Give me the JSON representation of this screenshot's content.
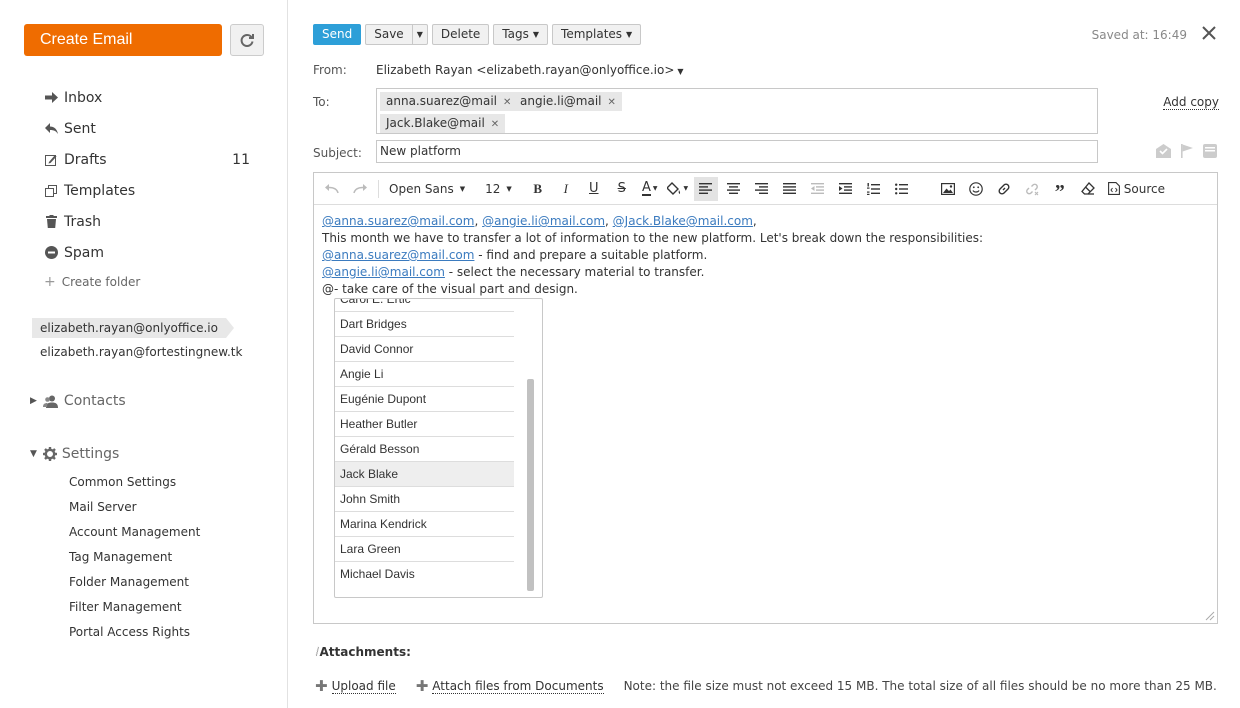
{
  "sidebar": {
    "create_email": "Create Email",
    "folders": [
      {
        "label": "Inbox",
        "count": ""
      },
      {
        "label": "Sent",
        "count": ""
      },
      {
        "label": "Drafts",
        "count": "11"
      },
      {
        "label": "Templates",
        "count": ""
      },
      {
        "label": "Trash",
        "count": ""
      },
      {
        "label": "Spam",
        "count": ""
      }
    ],
    "create_folder": "Create folder",
    "accounts": [
      "elizabeth.rayan@onlyoffice.io",
      "elizabeth.rayan@fortestingnew.tk"
    ],
    "contacts": "Contacts",
    "settings": "Settings",
    "settings_items": [
      "Common Settings",
      "Mail Server",
      "Account Management",
      "Tag Management",
      "Folder Management",
      "Filter Management",
      "Portal Access Rights"
    ]
  },
  "toolbar": {
    "send": "Send",
    "save": "Save",
    "delete": "Delete",
    "tags": "Tags",
    "templates": "Templates",
    "saved": "Saved at: 16:49"
  },
  "compose": {
    "from_label": "From:",
    "from_value": "Elizabeth Rayan <elizabeth.rayan@onlyoffice.io>",
    "to_label": "To:",
    "to_chips": [
      "anna.suarez@mail",
      "angie.li@mail",
      "Jack.Blake@mail"
    ],
    "add_copy": "Add copy",
    "subject_label": "Subject:",
    "subject_value": "New platform"
  },
  "editor": {
    "font": "Open Sans",
    "size": "12",
    "source": "Source",
    "line1_links": [
      "@anna.suarez@mail.com",
      "@angie.li@mail.com",
      "@Jack.Blake@mail.com"
    ],
    "line1_sep": ", ",
    "line1_end": ",",
    "line2": "This month we have to transfer a lot of information to the new platform. Let's break down the responsibilities:",
    "line3_link": "@anna.suarez@mail.com",
    "line3_text": " - find and prepare a suitable platform.",
    "line4_link": "@angie.li@mail.com",
    "line4_text": " - select the necessary material to transfer.",
    "line5": "@- take care of the visual part and design."
  },
  "mention_list": {
    "partial": "Carol E. Ertic",
    "items": [
      "Dart Bridges",
      "David Connor",
      "Angie Li",
      "Eugénie Dupont",
      "Heather Butler",
      "Gérald Besson",
      "Jack Blake",
      "John Smith",
      "Marina Kendrick",
      "Lara Green",
      "Michael Davis"
    ],
    "highlighted": "Jack Blake"
  },
  "attachments": {
    "title": "Attachments:",
    "upload": "Upload file",
    "attach_docs": "Attach files from Documents",
    "note": "Note: the file size must not exceed 15 MB. The total size of all files should be no more than 25 MB."
  }
}
